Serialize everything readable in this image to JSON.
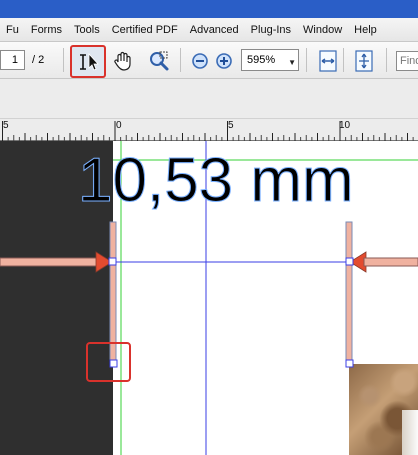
{
  "menu": {
    "items": [
      "Fu",
      "Forms",
      "Tools",
      "Certified PDF",
      "Advanced",
      "Plug-Ins",
      "Window",
      "Help"
    ]
  },
  "toolbar": {
    "page_current": "1",
    "page_total": "/ 2",
    "zoom_value": "595%",
    "zoom_arrow": "▼",
    "find_placeholder": "Find"
  },
  "ruler": {
    "labels": [
      "5",
      "0",
      "5",
      "10"
    ]
  },
  "document": {
    "measurement": "10,53 mm"
  },
  "colors": {
    "highlight_red": "#d9322c",
    "guide_blue": "#3a3de6",
    "guide_green": "#36d136",
    "arrow_red": "#e34b2f"
  },
  "icons": {
    "select": "select-tool-icon",
    "hand": "hand-tool-icon",
    "zoom": "marquee-zoom-icon",
    "zoom_out": "zoom-out-icon",
    "zoom_in": "zoom-in-icon",
    "fit_width": "fit-width-icon",
    "fit_page": "fit-page-icon"
  }
}
